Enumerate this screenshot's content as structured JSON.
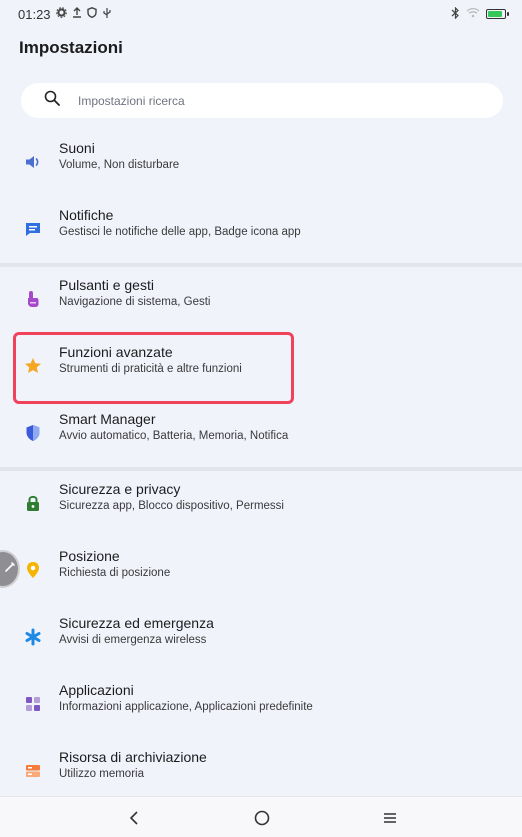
{
  "status_bar": {
    "time": "01:23",
    "icons_left": [
      "gear-icon",
      "upload-icon",
      "shield-icon",
      "usb-icon"
    ],
    "icons_right": [
      "bluetooth-icon",
      "wifi-icon",
      "battery-icon"
    ]
  },
  "header": {
    "title": "Impostazioni"
  },
  "search": {
    "placeholder": "Impostazioni ricerca"
  },
  "settings": [
    {
      "id": "suoni",
      "title": "Suoni",
      "subtitle": "Volume, Non disturbare",
      "icon": "speaker-icon",
      "color": "#4a6fd1"
    },
    {
      "id": "notifiche",
      "title": "Notifiche",
      "subtitle": "Gestisci le notifiche delle app, Badge icona app",
      "icon": "message-icon",
      "color": "#2f6fde"
    },
    {
      "id": "pulsanti",
      "title": "Pulsanti e gesti",
      "subtitle": "Navigazione di sistema, Gesti",
      "icon": "hand-icon",
      "color": "#a64ac9"
    },
    {
      "id": "funzioni",
      "title": "Funzioni avanzate",
      "subtitle": "Strumenti di praticità e altre funzioni",
      "icon": "star-icon",
      "color": "#f5a623"
    },
    {
      "id": "smart",
      "title": "Smart Manager",
      "subtitle": "Avvio automatico, Batteria, Memoria, Notifica",
      "icon": "shield-icon",
      "color": "#3b5bdb"
    },
    {
      "id": "sicurezza",
      "title": "Sicurezza e privacy",
      "subtitle": "Sicurezza app, Blocco dispositivo, Permessi",
      "icon": "lock-icon",
      "color": "#2e7d32"
    },
    {
      "id": "posizione",
      "title": "Posizione",
      "subtitle": "Richiesta di posizione",
      "icon": "location-icon",
      "color": "#f5b400"
    },
    {
      "id": "emergenza",
      "title": "Sicurezza ed emergenza",
      "subtitle": "Avvisi di emergenza wireless",
      "icon": "asterisk-icon",
      "color": "#1e88e5"
    },
    {
      "id": "applicazioni",
      "title": "Applicazioni",
      "subtitle": "Informazioni applicazione, Applicazioni predefinite",
      "icon": "apps-grid-icon",
      "color": "#7e57c2"
    },
    {
      "id": "archiviazione",
      "title": "Risorsa di archiviazione",
      "subtitle": "Utilizzo memoria",
      "icon": "storage-icon",
      "color": "#f57c3a"
    }
  ],
  "nav_bar": {
    "buttons": [
      "back-icon",
      "home-icon",
      "recents-icon"
    ]
  },
  "colors": {
    "background": "#f1f3fa",
    "highlight": "#f0425a"
  }
}
